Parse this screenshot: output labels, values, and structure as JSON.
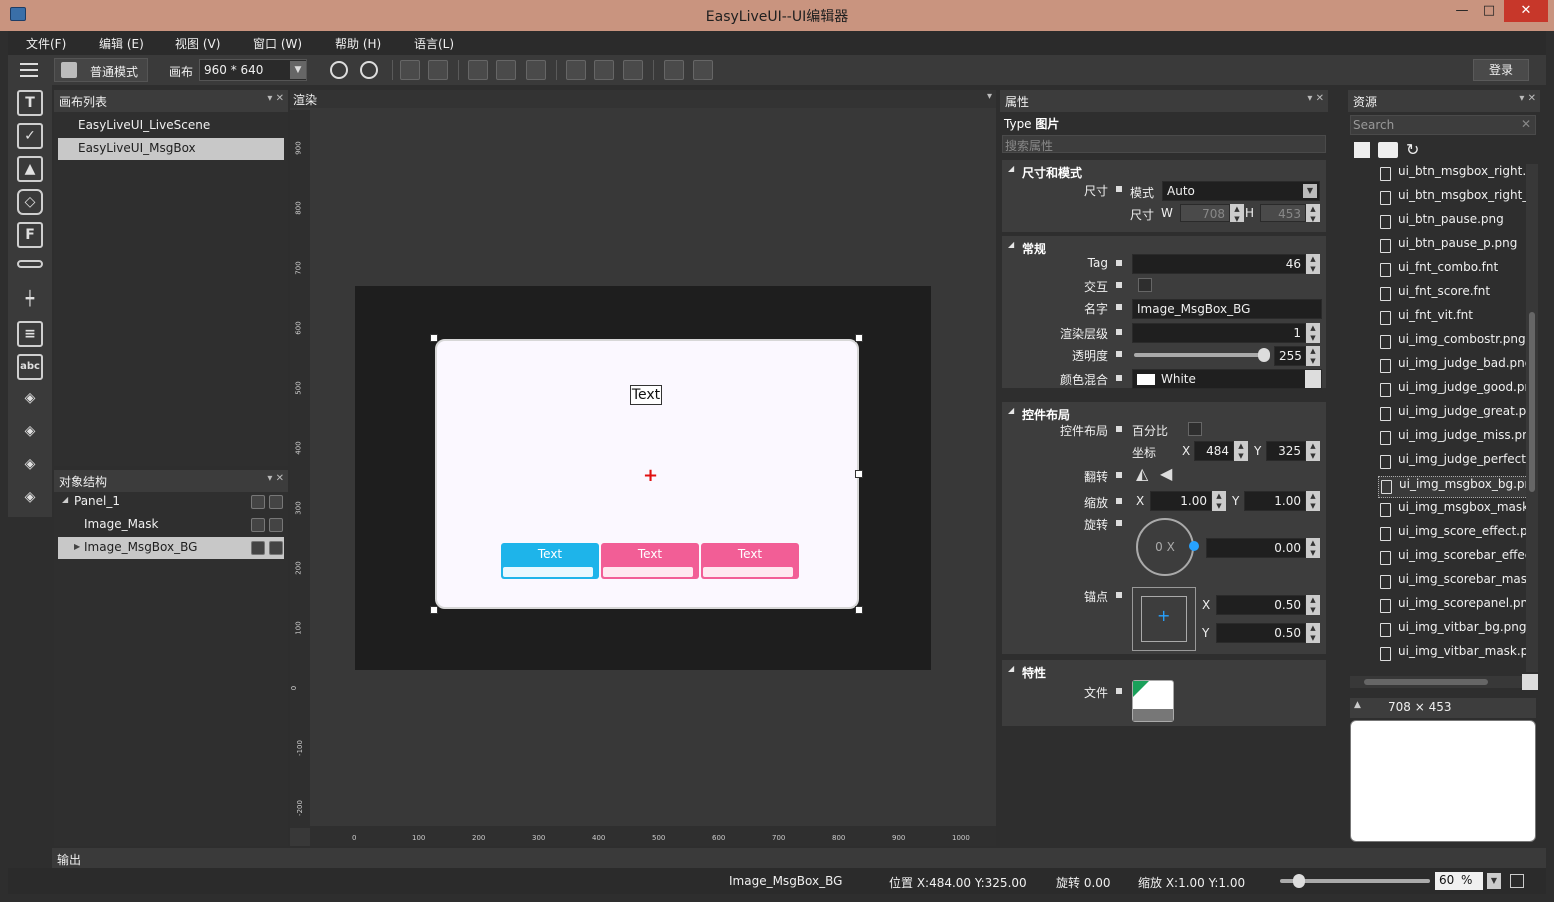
{
  "window": {
    "title": "EasyLiveUI--UI编辑器",
    "min": "—",
    "max": "□",
    "close": "✕"
  },
  "menu": [
    "文件(F)",
    "编辑 (E)",
    "视图 (V)",
    "窗口 (W)",
    "帮助 (H)",
    "语言(L)"
  ],
  "toolbar": {
    "mode": "普通模式",
    "canvas_label": "画布",
    "canvas_size": "960 * 640",
    "login": "登录"
  },
  "canvas_list": {
    "title": "画布列表",
    "items": [
      "EasyLiveUI_LiveScene",
      "EasyLiveUI_MsgBox"
    ]
  },
  "object_tree": {
    "title": "对象结构",
    "items": [
      "Panel_1",
      "Image_Mask",
      "Image_MsgBox_BG"
    ]
  },
  "render": {
    "title": "渲染",
    "text_label": "Text",
    "buttons": [
      "Text",
      "Text",
      "Text"
    ],
    "vticks": [
      "900",
      "800",
      "700",
      "600",
      "500",
      "400",
      "300",
      "200",
      "100",
      "0",
      "-100",
      "-200"
    ],
    "hticks": [
      "0",
      "100",
      "200",
      "300",
      "400",
      "500",
      "600",
      "700",
      "800",
      "900",
      "1000"
    ]
  },
  "props": {
    "title": "属性",
    "type_label": "Type",
    "type_value": "图片",
    "search_placeholder": "搜索属性",
    "size_section": "尺寸和模式",
    "size_label": "尺寸",
    "mode_label": "模式",
    "mode_value": "Auto",
    "size2_label": "尺寸",
    "w_label": "W",
    "w_value": "708",
    "h_label": "H",
    "h_value": "453",
    "general_section": "常规",
    "tag_label": "Tag",
    "tag_value": "46",
    "interact_label": "交互",
    "name_label": "名字",
    "name_value": "Image_MsgBox_BG",
    "layer_label": "渲染层级",
    "layer_value": "1",
    "alpha_label": "透明度",
    "alpha_value": "255",
    "blend_label": "颜色混合",
    "blend_value": "White",
    "layout_section": "控件布局",
    "layout_label": "控件布局",
    "percent_label": "百分比",
    "coord_label": "坐标",
    "x_label": "X",
    "x_value": "484",
    "y_label": "Y",
    "y_value": "325",
    "flip_label": "翻转",
    "scale_label": "缩放",
    "sx_value": "1.00",
    "sy_value": "1.00",
    "rotate_label": "旋转",
    "rotate_dial": "0 X",
    "rotate_value": "0.00",
    "anchor_label": "锚点",
    "ax_value": "0.50",
    "ay_value": "0.50",
    "feature_section": "特性",
    "file_label": "文件"
  },
  "resources": {
    "title": "资源",
    "search_placeholder": "Search",
    "files": [
      "ui_btn_msgbox_right.p",
      "ui_btn_msgbox_right_p",
      "ui_btn_pause.png",
      "ui_btn_pause_p.png",
      "ui_fnt_combo.fnt",
      "ui_fnt_score.fnt",
      "ui_fnt_vit.fnt",
      "ui_img_combostr.png",
      "ui_img_judge_bad.png",
      "ui_img_judge_good.pr",
      "ui_img_judge_great.pr",
      "ui_img_judge_miss.pn",
      "ui_img_judge_perfect.",
      "ui_img_msgbox_bg.pn",
      "ui_img_msgbox_mask.",
      "ui_img_score_effect.pr",
      "ui_img_scorebar_effec",
      "ui_img_scorebar_mask",
      "ui_img_scorepanel.png",
      "ui_img_vitbar_bg.png",
      "ui_img_vitbar_mask.pr"
    ],
    "preview_size": "708  ×  453"
  },
  "output": {
    "title": "输出"
  },
  "status": {
    "name": "Image_MsgBox_BG",
    "pos": "位置 X:484.00    Y:325.00",
    "rot": "旋转 0.00",
    "scale": "缩放 X:1.00    Y:1.00",
    "zoom": "60",
    "zoom_unit": "%"
  }
}
